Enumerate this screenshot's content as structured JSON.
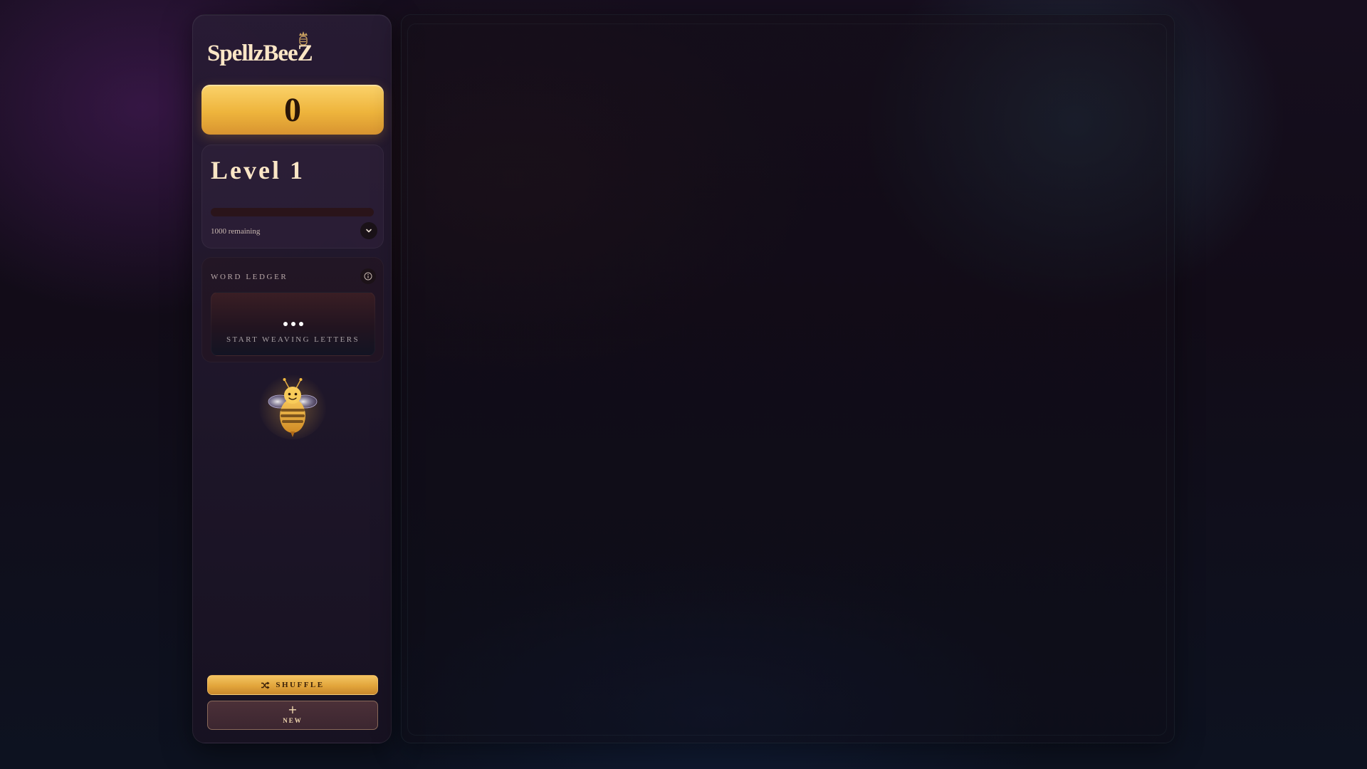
{
  "app": {
    "title": "SpellzBeeZ"
  },
  "score": {
    "value": "0"
  },
  "level": {
    "title": "Level 1",
    "progress_percent": 0,
    "remaining_text": "1000 remaining"
  },
  "ledger": {
    "title": "WORD LEDGER",
    "empty_text": "START WEAVING LETTERS"
  },
  "actions": {
    "shuffle_label": "SHUFFLE",
    "new_label": "NEW"
  },
  "icons": {
    "logo_ornament": "crown-icon",
    "level_toggle": "chevron-down-icon",
    "ledger_info": "info-icon",
    "ledger_placeholder": "ellipsis-icon",
    "shuffle": "shuffle-icon",
    "new": "plus-icon",
    "mascot": "bee-icon"
  },
  "colors": {
    "accent_gold": "#f0b640",
    "text_cream": "#fbe6c6",
    "score_text": "#2a1608"
  }
}
